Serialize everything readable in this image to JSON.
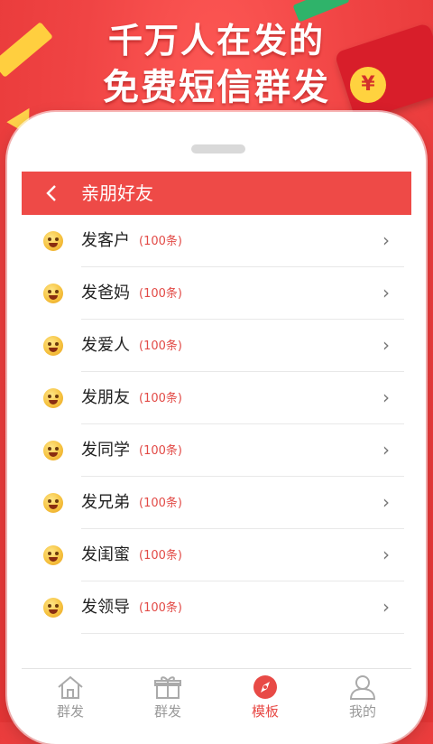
{
  "promo": {
    "line1": "千万人在发的",
    "line2": "免费短信群发",
    "coin_symbol": "¥"
  },
  "header": {
    "back_icon": "chevron-left-icon",
    "title": "亲朋好友"
  },
  "items": [
    {
      "label": "发客户",
      "count": "(100条)",
      "icon": "emoji-icon"
    },
    {
      "label": "发爸妈",
      "count": "(100条)",
      "icon": "emoji-icon"
    },
    {
      "label": "发爱人",
      "count": "(100条)",
      "icon": "emoji-icon"
    },
    {
      "label": "发朋友",
      "count": "(100条)",
      "icon": "emoji-icon"
    },
    {
      "label": "发同学",
      "count": "(100条)",
      "icon": "emoji-icon"
    },
    {
      "label": "发兄弟",
      "count": "(100条)",
      "icon": "emoji-icon"
    },
    {
      "label": "发闺蜜",
      "count": "(100条)",
      "icon": "emoji-icon"
    },
    {
      "label": "发领导",
      "count": "(100条)",
      "icon": "emoji-icon"
    }
  ],
  "tabs": [
    {
      "label": "群发",
      "icon": "home-icon",
      "active": false
    },
    {
      "label": "群发",
      "icon": "gift-icon",
      "active": false
    },
    {
      "label": "模板",
      "icon": "compass-icon",
      "active": true
    },
    {
      "label": "我的",
      "icon": "user-icon",
      "active": false
    }
  ],
  "colors": {
    "accent": "#ee4a47",
    "count_text": "#e24a46",
    "background": "#f04444"
  }
}
